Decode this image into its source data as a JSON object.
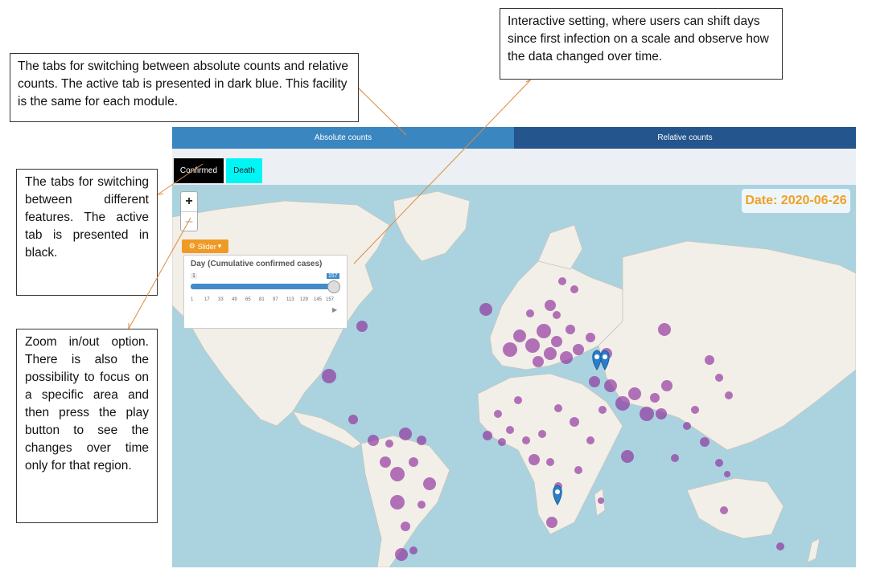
{
  "annotations": {
    "module_tabs": "The tabs for switching between absolute counts and relative counts. The active tab is presented in dark blue. This facility is the same for each module.",
    "slider": "Interactive setting, where users can shift days since first infection on a scale and observe how the data changed over time.",
    "feature_tabs": "The tabs for switching between different features. The active tab is presented in black.",
    "zoom": "Zoom in/out option. There is also the possibility to focus on a specific area and then press the play button to see the changes over time only for that region."
  },
  "module_tabs": {
    "absolute": "Absolute counts",
    "relative": "Relative counts"
  },
  "feature_tabs": {
    "confirmed": "Confirmed",
    "death": "Death"
  },
  "zoom": {
    "in": "+",
    "out": "–"
  },
  "date_label": "Date: 2020-06-26",
  "slider": {
    "button": "Slider",
    "title": "Day (Cumulative confirmed cases)",
    "min": "1",
    "max": "157",
    "ticks": [
      "1",
      "17",
      "33",
      "49",
      "65",
      "81",
      "97",
      "113",
      "129",
      "145",
      "157"
    ]
  },
  "colors": {
    "ocean": "#aad3df",
    "land": "#f2efe9",
    "bubble": "#8e2b9b",
    "marker": "#2b7ec8",
    "date_text": "#f0a026"
  }
}
